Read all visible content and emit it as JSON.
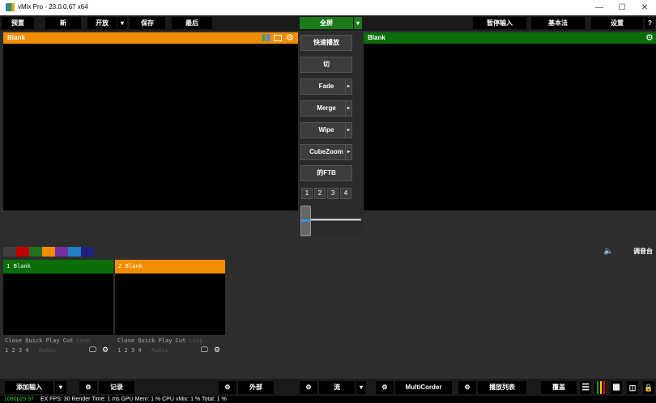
{
  "window": {
    "title": "vMix Pro - 23.0.0.67 x64",
    "minimize": "—",
    "maximize": "☐",
    "close": "✕"
  },
  "menubar": {
    "preset": "预置",
    "new": "新",
    "open": "开放",
    "save": "保存",
    "last": "最后",
    "fullscreen": "全屏",
    "pause_input": "暂停输入",
    "basic": "基本法",
    "settings": "设置",
    "help": "?"
  },
  "preview": {
    "label": "Blank"
  },
  "output": {
    "label": "Blank"
  },
  "transitions": {
    "quick_play": "快速播放",
    "cut": "切",
    "fade": "Fade",
    "merge": "Merge",
    "wipe": "Wipe",
    "cubezoom": "CubeZoom",
    "ftb": "的FTB",
    "numbers": [
      "1",
      "2",
      "3",
      "4"
    ]
  },
  "swatch_colors": [
    "#404040",
    "#c00000",
    "#207020",
    "#f28c00",
    "#7030a0",
    "#2080c0",
    "#202080"
  ],
  "audio": {
    "speaker_icon": "speaker-icon",
    "mixer_label": "调音台"
  },
  "inputs": [
    {
      "number": "1",
      "name": "Blank",
      "header_color": "#0b6e0b",
      "actions": [
        "Close",
        "Quick Play",
        "Cut",
        "Loop"
      ],
      "overlays": [
        "1",
        "2",
        "3",
        "4"
      ],
      "audio_label": "Audio"
    },
    {
      "number": "2",
      "name": "Blank",
      "header_color": "#f28c00",
      "actions": [
        "Close",
        "Quick Play",
        "Cut",
        "Loop"
      ],
      "overlays": [
        "1",
        "2",
        "3",
        "4"
      ],
      "audio_label": "Audio"
    }
  ],
  "bottombar": {
    "add_input": "添加输入",
    "record": "记录",
    "external": "外部",
    "stream": "流",
    "multicorder": "MultiCorder",
    "playlist": "播放列表",
    "overlay": "覆盖"
  },
  "status": {
    "format": "1080p29.97",
    "stats": "EX FPS: 30  Render Time: 1 ms  GPU Mem: 1 %  CPU vMix: 1 %  Total: 1 %"
  }
}
